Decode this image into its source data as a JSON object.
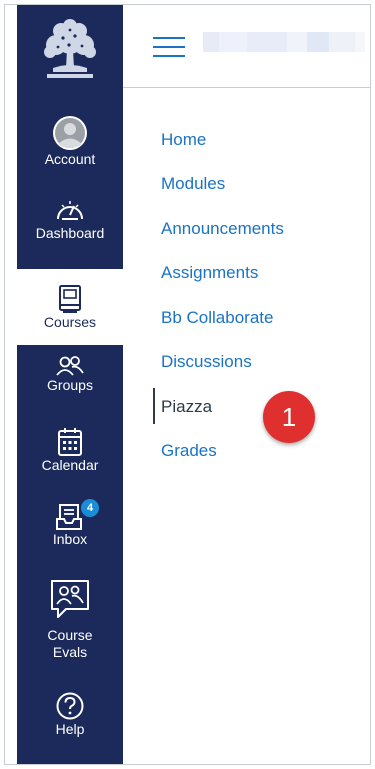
{
  "colors": {
    "sidebar_bg": "#1b2a5a",
    "link_color": "#1a73c4",
    "active_text": "#2d3b45",
    "badge_bg": "#1a8cd8",
    "callout_bg": "#e02f2f"
  },
  "global_nav": {
    "logo_icon": "tree-seal-logo",
    "items": [
      {
        "label": "Account",
        "icon": "user-avatar-icon",
        "active": false
      },
      {
        "label": "Dashboard",
        "icon": "speedometer-icon",
        "active": false
      },
      {
        "label": "Courses",
        "icon": "book-icon",
        "active": true
      },
      {
        "label": "Groups",
        "icon": "people-icon",
        "active": false
      },
      {
        "label": "Calendar",
        "icon": "calendar-icon",
        "active": false
      },
      {
        "label": "Inbox",
        "icon": "inbox-icon",
        "active": false,
        "badge": "4"
      },
      {
        "label": "Course\nEvals",
        "icon": "speech-bubble-people-icon",
        "active": false
      },
      {
        "label": "Help",
        "icon": "question-circle-icon",
        "active": false
      }
    ]
  },
  "topbar": {
    "menu_icon": "hamburger-menu-icon"
  },
  "course_nav": {
    "items": [
      {
        "label": "Home",
        "current": false
      },
      {
        "label": "Modules",
        "current": false
      },
      {
        "label": "Announcements",
        "current": false
      },
      {
        "label": "Assignments",
        "current": false
      },
      {
        "label": "Bb Collaborate",
        "current": false
      },
      {
        "label": "Discussions",
        "current": false
      },
      {
        "label": "Piazza",
        "current": true
      },
      {
        "label": "Grades",
        "current": false
      }
    ]
  },
  "callout": {
    "number": "1"
  }
}
